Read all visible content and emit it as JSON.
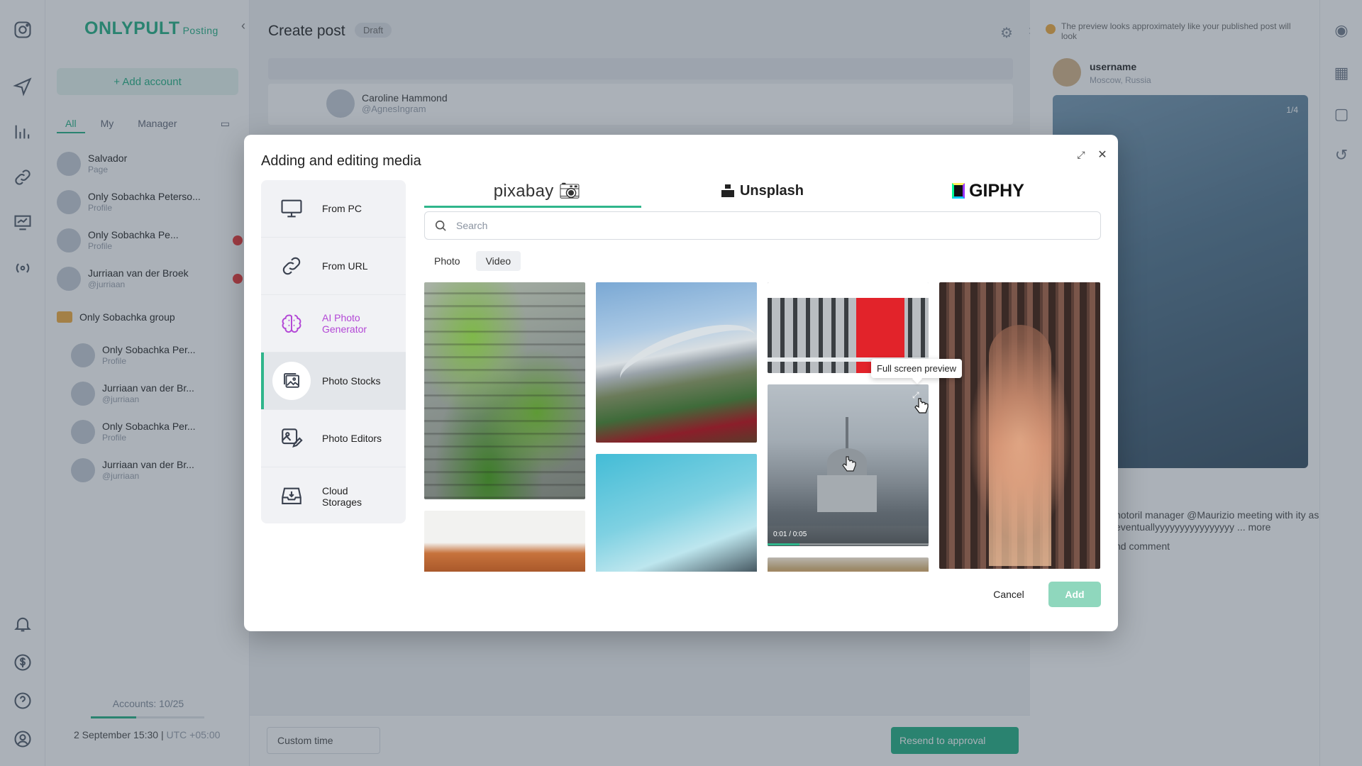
{
  "app": {
    "logo_text": "ONLYPULT",
    "logo_sub": "Posting"
  },
  "accounts_panel": {
    "add_account_label": "+ Add account",
    "tabs": [
      {
        "label": "All",
        "active": true
      },
      {
        "label": "My"
      },
      {
        "label": "Manager"
      }
    ],
    "items": [
      {
        "name": "Salvador",
        "sub": "Page"
      },
      {
        "name": "Only Sobachka Peterso...",
        "sub": "Profile"
      },
      {
        "name": "Only Sobachka Pe...",
        "sub": "Profile"
      },
      {
        "name": "Jurriaan van der Broek",
        "sub": "@jurriaan"
      },
      {
        "name": "Only Sobachka group",
        "sub": ""
      },
      {
        "name": "Only Sobachka Per...",
        "sub": "Profile"
      },
      {
        "name": "Jurriaan van der Br...",
        "sub": "@jurriaan"
      },
      {
        "name": "Only Sobachka Per...",
        "sub": "Profile"
      },
      {
        "name": "Jurriaan van der Br...",
        "sub": "@jurriaan"
      }
    ],
    "footer_count": "Accounts: 10/25",
    "footer_count_progress": 0.4,
    "footer_time": "2 September 15:30",
    "footer_tz": "UTC +05:00"
  },
  "editor": {
    "title": "Create post",
    "status_badge": "Draft",
    "author_name": "Caroline Hammond",
    "author_handle": "@AgnesIngram",
    "custom_time_label": "Custom time",
    "resend_label": "Resend to approval"
  },
  "preview": {
    "note": "The preview looks approximately like your published post will look",
    "username": "username",
    "location": "Moscow, Russia",
    "counter": "1/4",
    "text": "notoril manager @Maurizio meeting with ity as eventuallyyyyyyyyyyyyyyyy ... more",
    "comment": "nd comment"
  },
  "modal": {
    "title": "Adding and editing media",
    "sources": [
      {
        "label": "From PC",
        "icon": "monitor-icon"
      },
      {
        "label": "From URL",
        "icon": "link-icon"
      },
      {
        "label": "AI Photo Generator",
        "icon": "brain-icon"
      },
      {
        "label": "Photo Stocks",
        "icon": "image-stack-icon",
        "active": true
      },
      {
        "label": "Photo Editors",
        "icon": "image-edit-icon"
      },
      {
        "label": "Cloud Storages",
        "icon": "cloud-storage-icon"
      }
    ],
    "providers": [
      {
        "label": "pixabay",
        "active": true
      },
      {
        "label": "Unsplash"
      },
      {
        "label": "GIPHY"
      }
    ],
    "search_placeholder": "Search",
    "search_value": "",
    "media_types": [
      {
        "label": "Photo"
      },
      {
        "label": "Video",
        "active": true
      }
    ],
    "video_timecode": "0:01 / 0:05",
    "video_progress": 0.2,
    "tooltip": "Full screen preview",
    "cancel_label": "Cancel",
    "add_label": "Add"
  },
  "colors": {
    "accent": "#2fb58b",
    "ai_purple": "#b347d6",
    "overlay": "rgba(35,50,68,0.38)"
  }
}
